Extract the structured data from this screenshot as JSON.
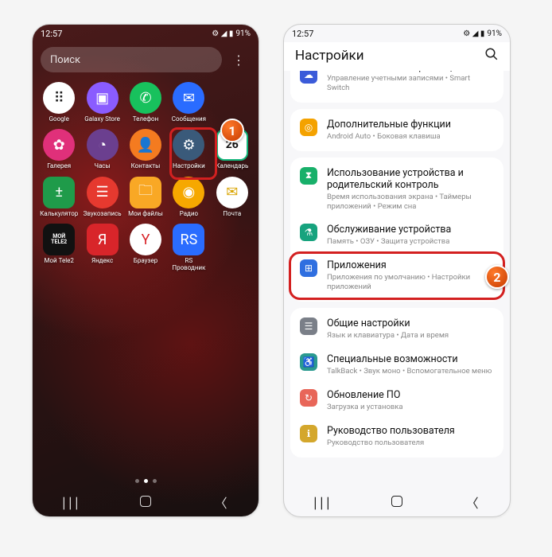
{
  "status": {
    "time": "12:57",
    "battery": "91%",
    "icons": "⚙ ◢ ▮"
  },
  "left": {
    "search_placeholder": "Поиск",
    "apps": [
      {
        "label": "Google",
        "bg": "#fff",
        "fg": "#222",
        "glyph": "⠿",
        "round": true
      },
      {
        "label": "Galaxy Store",
        "bg": "#8a5cff",
        "glyph": "▣",
        "round": true
      },
      {
        "label": "Телефон",
        "bg": "#18c15d",
        "glyph": "✆",
        "round": true
      },
      {
        "label": "Сообщения",
        "bg": "#2a6cff",
        "glyph": "✉",
        "round": true
      },
      {
        "label": "",
        "bg": "transparent",
        "glyph": ""
      },
      {
        "label": "Галерея",
        "bg": "#e0307a",
        "glyph": "✿",
        "round": true
      },
      {
        "label": "Часы",
        "bg": "#6b3f8f",
        "glyph": "◔",
        "round": true
      },
      {
        "label": "Контакты",
        "bg": "#f47b20",
        "glyph": "👤",
        "round": true
      },
      {
        "label": "Настройки",
        "bg": "#3a5a7a",
        "glyph": "⚙",
        "round": true
      },
      {
        "label": "Календарь",
        "bg": "#11b57a",
        "glyph": "26"
      },
      {
        "label": "Калькулятор",
        "bg": "#1f9b4a",
        "glyph": "±"
      },
      {
        "label": "Звукозапись",
        "bg": "#e6392f",
        "glyph": "☰",
        "round": true
      },
      {
        "label": "Мои файлы",
        "bg": "#f9a825",
        "glyph": "🗀"
      },
      {
        "label": "Радио",
        "bg": "#f6a800",
        "glyph": "◉",
        "round": true
      },
      {
        "label": "Почта",
        "bg": "#fff",
        "glyph": "✉",
        "fg": "#d9a400",
        "round": true
      },
      {
        "label": "Мой Tele2",
        "bg": "#111",
        "glyph": "МОЙ\\nTELE2",
        "small": true
      },
      {
        "label": "Яндекс",
        "bg": "#d8252a",
        "glyph": "Я"
      },
      {
        "label": "Браузер",
        "bg": "#fff",
        "fg": "#d8252a",
        "glyph": "Y",
        "round": true
      },
      {
        "label": "RS\\nПроводник",
        "bg": "#2a6cff",
        "glyph": "RS"
      }
    ],
    "marker": "1"
  },
  "right": {
    "header": "Настройки",
    "marker": "2",
    "groups": [
      [
        {
          "icon_bg": "#3b5bd9",
          "glyph": "☁",
          "title": "Учетные записи и архивация",
          "sub": "Управление учетными записями • Smart Switch",
          "truncated": true
        }
      ],
      [
        {
          "icon_bg": "#f4a200",
          "glyph": "◎",
          "title": "Дополнительные функции",
          "sub": "Android Auto • Боковая клавиша"
        }
      ],
      [
        {
          "icon_bg": "#18b06a",
          "glyph": "⧗",
          "title": "Использование устройства и родительский контроль",
          "sub": "Время использования экрана • Таймеры приложений • Режим сна"
        },
        {
          "icon_bg": "#17a37e",
          "glyph": "⚗",
          "title": "Обслуживание устройства",
          "sub": "Память • ОЗУ • Защита устройства"
        },
        {
          "icon_bg": "#2f6fe0",
          "glyph": "⊞",
          "title": "Приложения",
          "sub": "Приложения по умолчанию • Настройки приложений",
          "highlighted": true
        }
      ],
      [
        {
          "icon_bg": "#7a7f88",
          "glyph": "☰",
          "title": "Общие настройки",
          "sub": "Язык и клавиатура • Дата и время"
        },
        {
          "icon_bg": "#2a9a8f",
          "glyph": "♿",
          "title": "Специальные возможности",
          "sub": "TalkBack • Звук моно • Вспомогательное меню"
        },
        {
          "icon_bg": "#e86659",
          "glyph": "↻",
          "title": "Обновление ПО",
          "sub": "Загрузка и установка"
        },
        {
          "icon_bg": "#d4a72c",
          "glyph": "ℹ",
          "title": "Руководство пользователя",
          "sub": "Руководство пользователя"
        }
      ]
    ]
  }
}
